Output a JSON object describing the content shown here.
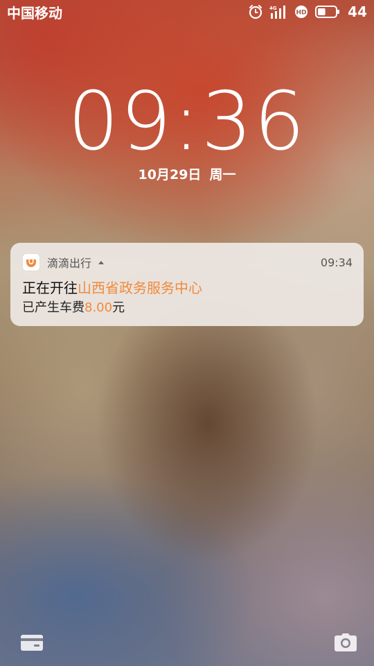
{
  "status_bar": {
    "carrier": "中国移动",
    "network_type": "4G",
    "hd_label": "HD",
    "battery_level": "44",
    "battery_fill": 0.44,
    "icons": [
      "alarm-icon",
      "signal-icon",
      "hd-call-icon",
      "battery-icon"
    ]
  },
  "lockscreen": {
    "time": "09:36",
    "date": "10月29日",
    "weekday": "周一"
  },
  "notification": {
    "app_name": "滴滴出行",
    "time": "09:34",
    "title_prefix": "正在开往",
    "destination": "山西省政务服务中心",
    "fare_prefix": "已产生车费",
    "fare_amount": "8.00",
    "fare_unit": "元",
    "highlight_color": "#f08a3c",
    "app_icon_color": "#f08a3c",
    "icons": [
      "didi-app-icon",
      "expand-arrow-icon"
    ]
  },
  "bottom": {
    "icons": [
      "wallet-icon",
      "camera-icon"
    ]
  }
}
